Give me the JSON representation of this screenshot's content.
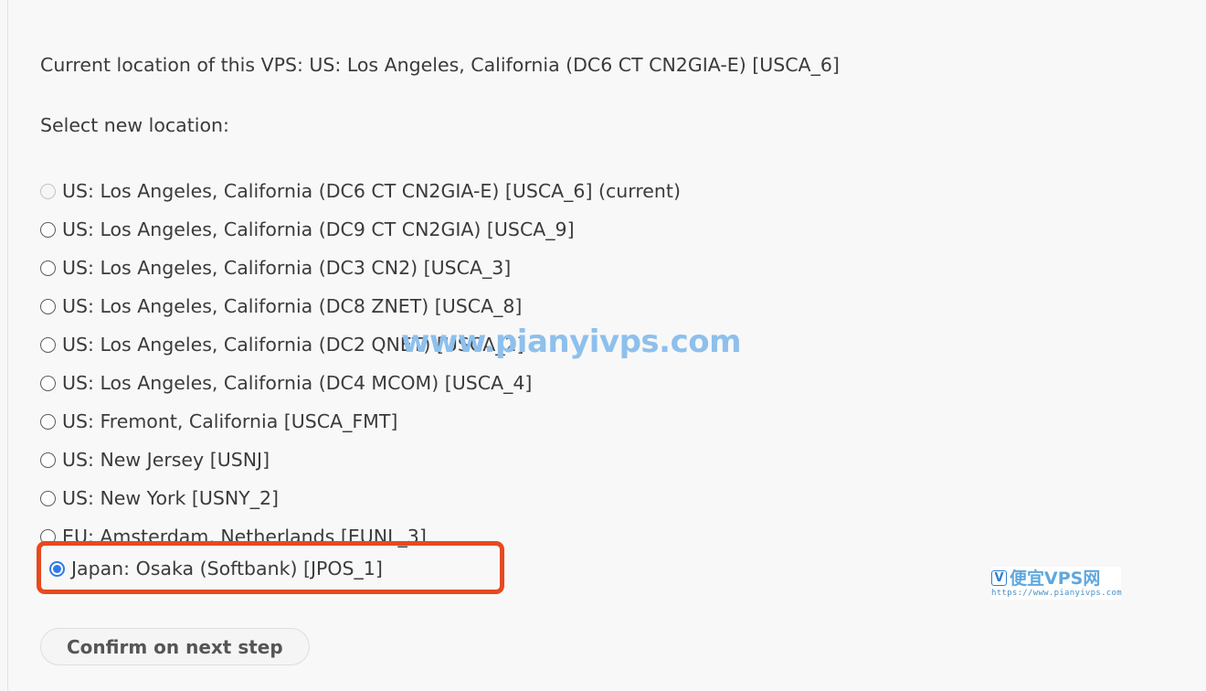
{
  "page": {
    "background_color": "#f8f8f8",
    "current_location_text": "Current location of this VPS: US: Los Angeles, California (DC6 CT CN2GIA-E) [USCA_6]",
    "select_prompt": "Select new location:"
  },
  "locations": [
    {
      "label": "US: Los Angeles, California (DC6 CT CN2GIA-E) [USCA_6] (current)",
      "state": "disabled"
    },
    {
      "label": "US: Los Angeles, California (DC9 CT CN2GIA) [USCA_9]",
      "state": "unchecked"
    },
    {
      "label": "US: Los Angeles, California (DC3 CN2) [USCA_3]",
      "state": "unchecked"
    },
    {
      "label": "US: Los Angeles, California (DC8 ZNET) [USCA_8]",
      "state": "unchecked"
    },
    {
      "label": "US: Los Angeles, California (DC2 QNET) [USCA_2]",
      "state": "unchecked"
    },
    {
      "label": "US: Los Angeles, California (DC4 MCOM) [USCA_4]",
      "state": "unchecked"
    },
    {
      "label": "US: Fremont, California [USCA_FMT]",
      "state": "unchecked"
    },
    {
      "label": "US: New Jersey [USNJ]",
      "state": "unchecked"
    },
    {
      "label": "US: New York [USNY_2]",
      "state": "unchecked"
    },
    {
      "label": "EU: Amsterdam, Netherlands [EUNL_3]",
      "state": "unchecked"
    }
  ],
  "selected_location": {
    "label": "Japan: Osaka (Softbank) [JPOS_1]",
    "state": "checked",
    "highlight_color": "#e8491f"
  },
  "confirm_button": {
    "label": "Confirm on next step"
  },
  "watermark": {
    "text": "www.pianyivps.com",
    "color": "#8ec0ec"
  },
  "site_logo": {
    "mark": "V",
    "name": "便宜VPS网",
    "url": "https://www.pianyivps.com"
  }
}
